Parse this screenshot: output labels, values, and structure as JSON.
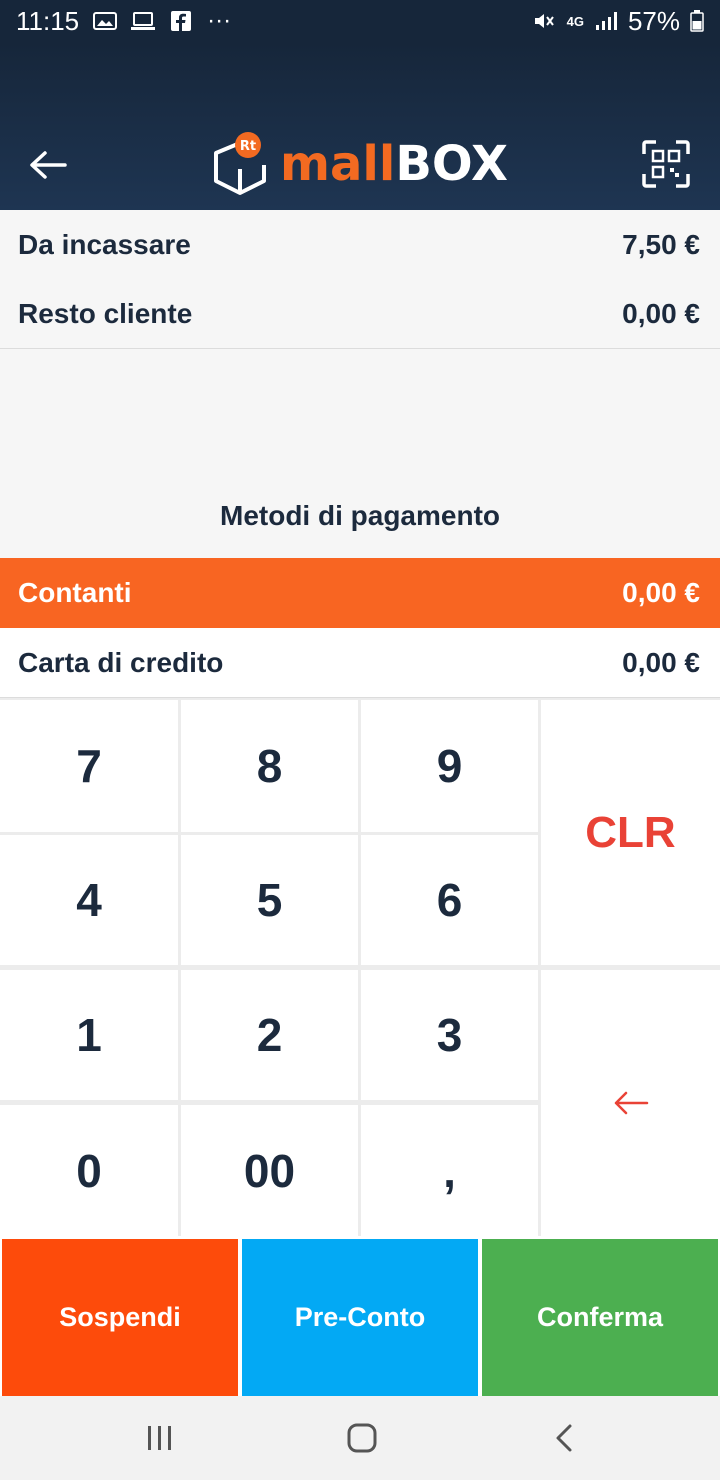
{
  "status_bar": {
    "time": "11:15",
    "overflow": "···",
    "network": "4G",
    "battery": "57%",
    "icons": [
      "gallery-icon",
      "laptop-icon",
      "facebook-icon",
      "mute-icon",
      "signal-icon",
      "battery-icon"
    ]
  },
  "header": {
    "logo_badge": "Rt",
    "logo_mall": "mall",
    "logo_box": "BOX",
    "colors": {
      "background": "#16263a",
      "brand_orange": "#f36a21"
    }
  },
  "summary": {
    "da_incassare_label": "Da incassare",
    "da_incassare_value": "7,50 €",
    "resto_label": "Resto cliente",
    "resto_value": "0,00 €"
  },
  "methods": {
    "title": "Metodi di pagamento",
    "items": [
      {
        "label": "Contanti",
        "value": "0,00 €",
        "selected": true
      },
      {
        "label": "Carta di credito",
        "value": "0,00 €",
        "selected": false
      }
    ],
    "selected_color": "#f86522"
  },
  "keypad": {
    "k7": "7",
    "k8": "8",
    "k9": "9",
    "k4": "4",
    "k5": "5",
    "k6": "6",
    "k1": "1",
    "k2": "2",
    "k3": "3",
    "k0": "0",
    "k00": "00",
    "comma": ",",
    "clr": "CLR",
    "backspace_icon": "arrow-left-icon"
  },
  "actions": {
    "sospendi": "Sospendi",
    "preconto": "Pre-Conto",
    "conferma": "Conferma",
    "colors": {
      "sospendi": "#fd4b0b",
      "preconto": "#03a9f4",
      "conferma": "#4caf50"
    }
  },
  "navbar": {
    "icons": [
      "recent-apps-icon",
      "home-icon",
      "back-icon"
    ]
  }
}
